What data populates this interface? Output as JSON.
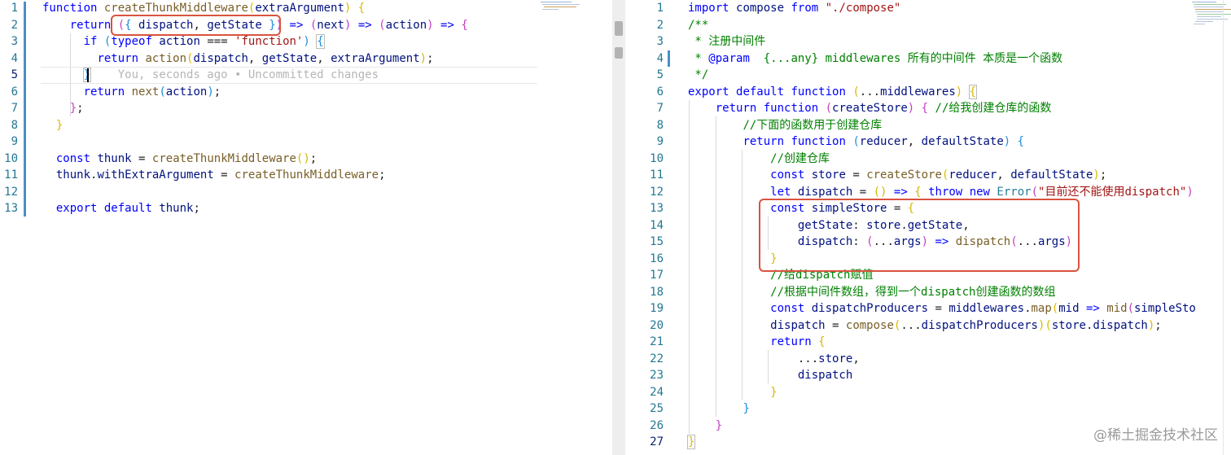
{
  "left_editor": {
    "lines": [
      {
        "n": "1"
      },
      {
        "n": "2"
      },
      {
        "n": "3"
      },
      {
        "n": "4"
      },
      {
        "n": "5"
      },
      {
        "n": "6"
      },
      {
        "n": "7"
      },
      {
        "n": "8"
      },
      {
        "n": "9"
      },
      {
        "n": "10"
      },
      {
        "n": "11"
      },
      {
        "n": "12"
      },
      {
        "n": "13"
      }
    ],
    "tokens": {
      "function_kw": "function",
      "fn_name": "createThunkMiddleware",
      "param": "extraArgument",
      "return_kw": "return",
      "dispatch": "dispatch",
      "getState": "getState",
      "arrow": "=>",
      "next": "next",
      "action": "action",
      "if_kw": "if",
      "typeof_kw": "typeof",
      "string_function": "'function'",
      "blame": "You, seconds ago • Uncommitted changes",
      "const_kw": "const",
      "thunk": "thunk",
      "withExtraArgument": "withExtraArgument",
      "export_kw": "export",
      "default_kw": "default"
    }
  },
  "right_editor": {
    "lines": [
      {
        "n": "1"
      },
      {
        "n": "2"
      },
      {
        "n": "3"
      },
      {
        "n": "4"
      },
      {
        "n": "5"
      },
      {
        "n": "6"
      },
      {
        "n": "7"
      },
      {
        "n": "8"
      },
      {
        "n": "9"
      },
      {
        "n": "10"
      },
      {
        "n": "11"
      },
      {
        "n": "12"
      },
      {
        "n": "13"
      },
      {
        "n": "14"
      },
      {
        "n": "15"
      },
      {
        "n": "16"
      },
      {
        "n": "17"
      },
      {
        "n": "18"
      },
      {
        "n": "19"
      },
      {
        "n": "20"
      },
      {
        "n": "21"
      },
      {
        "n": "22"
      },
      {
        "n": "23"
      },
      {
        "n": "24"
      },
      {
        "n": "25"
      },
      {
        "n": "26"
      },
      {
        "n": "27"
      }
    ],
    "tokens": {
      "import_kw": "import",
      "compose": "compose",
      "from_kw": "from",
      "compose_path": "\"./compose\"",
      "comment_open": "/**",
      "comment_line3": " * 注册中间件",
      "comment_line4_star": " *",
      "comment_param": "@param",
      "comment_line4_rest": "{...any} middlewares 所有的中间件 本质是一个函数",
      "comment_close": " */",
      "export_kw": "export",
      "default_kw": "default",
      "function_kw": "function",
      "middlewares": "middlewares",
      "return_kw": "return",
      "createStore": "createStore",
      "comment_line7": "//给我创建仓库的函数",
      "comment_line8": "//下面的函数用于创建仓库",
      "reducer": "reducer",
      "defaultState": "defaultState",
      "comment_line10": "//创建仓库",
      "const_kw": "const",
      "store": "store",
      "let_kw": "let",
      "dispatch": "dispatch",
      "throw_kw": "throw",
      "new_kw": "new",
      "Error": "Error",
      "error_msg": "\"目前还不能使用dispatch\"",
      "simpleStore": "simpleStore",
      "getState": "getState",
      "args": "args",
      "comment_line17": "//给dispatch赋值",
      "comment_line18": "//根据中间件数组，得到一个dispatch创建函数的数组",
      "dispatchProducers": "dispatchProducers",
      "map": "map",
      "mid": "mid",
      "simpleSto_trunc": "simpleSto"
    }
  },
  "watermark": "@稀土掘金技术社区",
  "colors": {
    "keyword": "#0000ff",
    "function_name": "#795e26",
    "variable": "#001080",
    "string": "#a31515",
    "comment": "#008000",
    "line_number": "#237893",
    "highlight_box": "#d9533f",
    "git_gutter": "#4a8fc9"
  }
}
